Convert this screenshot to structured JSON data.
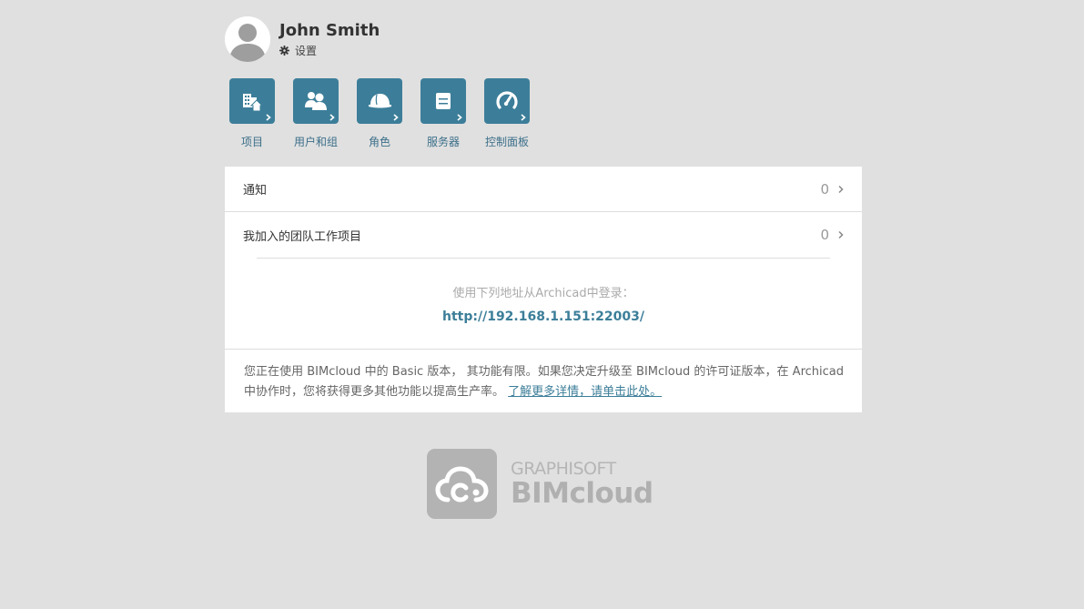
{
  "profile": {
    "name": "John Smith",
    "settings_label": "设置"
  },
  "tiles": [
    {
      "label": "项目",
      "icon": "project-icon"
    },
    {
      "label": "用户和组",
      "icon": "users-icon"
    },
    {
      "label": "角色",
      "icon": "helmet-icon"
    },
    {
      "label": "服务器",
      "icon": "server-icon"
    },
    {
      "label": "控制面板",
      "icon": "dashboard-icon"
    }
  ],
  "rows": {
    "notifications": {
      "label": "通知",
      "count": "0"
    },
    "team_projects": {
      "label": "我加入的团队工作项目",
      "count": "0"
    }
  },
  "login": {
    "hint": "使用下列地址从Archicad中登录：",
    "url": "http://192.168.1.151:22003/"
  },
  "notice": {
    "text": "您正在使用 BIMcloud 中的 Basic 版本， 其功能有限。如果您决定升级至 BIMcloud 的许可证版本，在 Archicad中协作时，您将获得更多其他功能以提高生产率。",
    "link": "了解更多详情，请单击此处。"
  },
  "logo": {
    "sub": "GRAPHISOFT",
    "main": "BIMcloud"
  },
  "colors": {
    "accent": "#3c7e99",
    "background": "#e0e0e0",
    "card": "#ffffff"
  }
}
